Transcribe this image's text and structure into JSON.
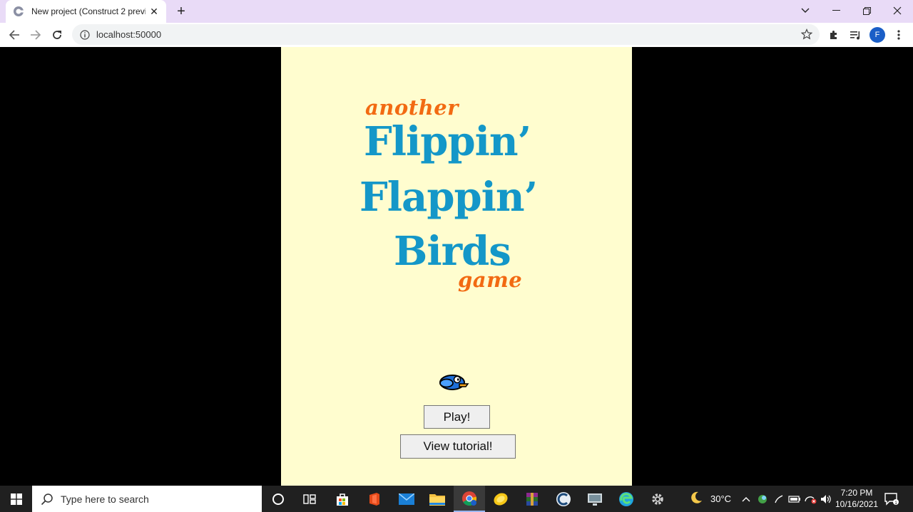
{
  "browser": {
    "tab_title": "New project (Construct 2 preview",
    "url": "localhost:50000",
    "profile_initial": "F"
  },
  "game": {
    "title_line1": "another",
    "title_line2": "Flippin’",
    "title_line3": "Flappin’",
    "title_line4": "Birds",
    "title_line5": "game",
    "play_label": "Play!",
    "tutorial_label": "View tutorial!"
  },
  "taskbar": {
    "search_placeholder": "Type here to search",
    "weather": "30°C",
    "time": "7:20 PM",
    "date": "10/16/2021"
  },
  "colors": {
    "tabbar_bg": "#e9dbf7",
    "game_bg": "#fffdcf",
    "title_blue": "#1497c8",
    "title_orange": "#f26a12"
  }
}
